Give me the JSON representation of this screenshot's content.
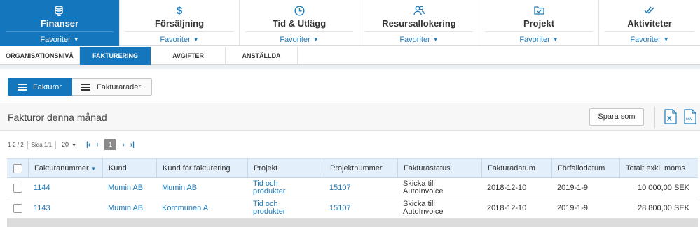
{
  "topnav": {
    "items": [
      {
        "label": "Finanser",
        "fav": "Favoriter",
        "icon": "finance-icon",
        "active": true
      },
      {
        "label": "Försäljning",
        "fav": "Favoriter",
        "icon": "dollar-icon",
        "active": false
      },
      {
        "label": "Tid & Utlägg",
        "fav": "Favoriter",
        "icon": "clock-icon",
        "active": false
      },
      {
        "label": "Resursallokering",
        "fav": "Favoriter",
        "icon": "users-icon",
        "active": false
      },
      {
        "label": "Projekt",
        "fav": "Favoriter",
        "icon": "folder-icon",
        "active": false
      },
      {
        "label": "Aktiviteter",
        "fav": "Favoriter",
        "icon": "check-icon",
        "active": false
      }
    ]
  },
  "subnav": {
    "items": [
      {
        "label": "ORGANISATIONSNIVÅ",
        "active": false
      },
      {
        "label": "FAKTURERING",
        "active": true
      },
      {
        "label": "AVGIFTER",
        "active": false
      },
      {
        "label": "ANSTÄLLDA",
        "active": false
      }
    ]
  },
  "view_toggle": {
    "invoices_label": "Fakturor",
    "invoice_rows_label": "Fakturarader"
  },
  "panel": {
    "title": "Fakturor denna månad",
    "save_as_label": "Spara som",
    "export_excel_label": "X",
    "export_csv_label": "csv"
  },
  "pager": {
    "range": "1-2 / 2",
    "page_of": "Sida 1/1",
    "page_size": "20",
    "current_page": "1"
  },
  "table": {
    "columns": [
      "Fakturanummer",
      "Kund",
      "Kund för fakturering",
      "Projekt",
      "Projektnummer",
      "Fakturastatus",
      "Fakturadatum",
      "Förfallodatum",
      "Totalt exkl. moms"
    ],
    "rows": [
      {
        "number": "1144",
        "customer": "Mumin AB",
        "billing_customer": "Mumin AB",
        "project_line1": "Tid och",
        "project_line2": "produkter",
        "project_number": "15107",
        "status_line1": "Skicka till",
        "status_line2": "AutoInvoice",
        "invoice_date": "2018-12-10",
        "due_date": "2019-1-9",
        "total": "10 000,00 SEK"
      },
      {
        "number": "1143",
        "customer": "Mumin AB",
        "billing_customer": "Kommunen A",
        "project_line1": "Tid och",
        "project_line2": "produkter",
        "project_number": "15107",
        "status_line1": "Skicka till",
        "status_line2": "AutoInvoice",
        "invoice_date": "2018-12-10",
        "due_date": "2019-1-9",
        "total": "28 800,00 SEK"
      }
    ]
  },
  "colors": {
    "accent": "#1476bd",
    "link": "#1f7ab8",
    "header_bg": "#e3f0fb",
    "excel_green": "#1f7a3c"
  }
}
